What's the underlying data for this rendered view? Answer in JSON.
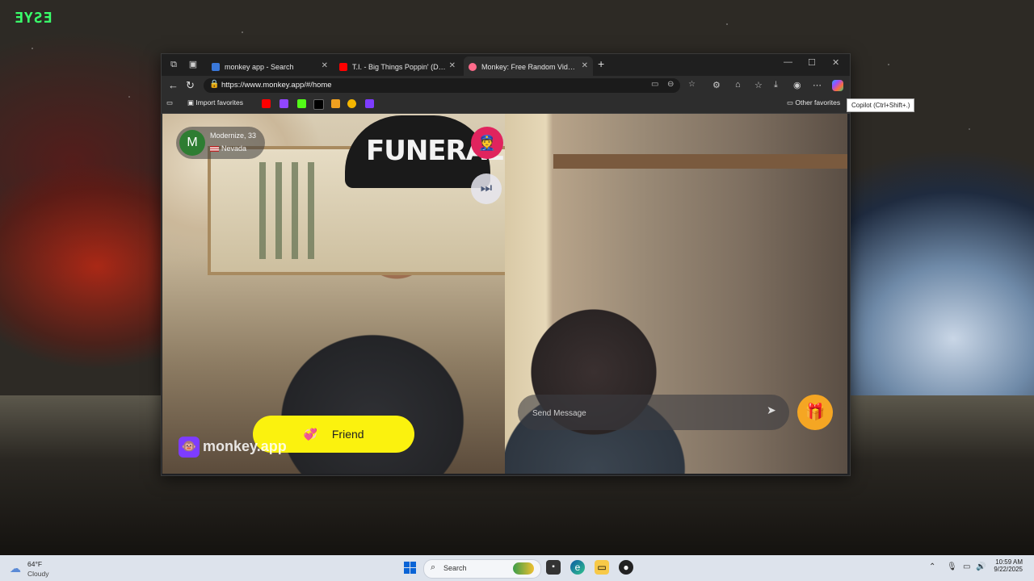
{
  "desktop": {
    "logo_text": "ƎYƧƎ"
  },
  "browser": {
    "tabs": [
      {
        "title": "monkey app - Search",
        "favicon_color": "#3a78d9"
      },
      {
        "title": "T.I. - Big Things Poppin' (Do It) [O…",
        "favicon_color": "#ff0000"
      },
      {
        "title": "Monkey: Free Random Video Chat",
        "favicon_color": "#ff6b8b",
        "active": true
      }
    ],
    "address": {
      "url": "https://www.monkey.app/#/home"
    },
    "favorites_bar": {
      "import_label": "Import favorites",
      "other_label": "Other favorites",
      "icons": [
        {
          "name": "youtube-favicon",
          "color": "#ff0000"
        },
        {
          "name": "twitch-favicon",
          "color": "#9146ff"
        },
        {
          "name": "kick-favicon",
          "color": "#53fc18"
        },
        {
          "name": "x-favicon",
          "color": "#000000"
        },
        {
          "name": "chess-favicon",
          "color": "#f0a020"
        },
        {
          "name": "spotify-favicon",
          "color": "#f5b700"
        },
        {
          "name": "purple-favicon",
          "color": "#7d3cff"
        }
      ]
    },
    "copilot_tooltip": "Copilot (Ctrl+Shift+.)"
  },
  "app": {
    "stranger": {
      "initial": "M",
      "name_age": "Modernize, 33",
      "location": "Nevada"
    },
    "cap_text": "FUNERAL",
    "friend_button": "Friend",
    "brand": "monkey.app",
    "message_placeholder": "Send Message"
  },
  "taskbar": {
    "weather": {
      "temp": "64°F",
      "condition": "Cloudy"
    },
    "search_label": "Search",
    "clock": {
      "time": "10:59 AM",
      "date": "9/22/2025"
    }
  },
  "colors": {
    "accent_yellow": "#fbf20e",
    "report_pink": "#e0245e",
    "gift_orange": "#f5a623",
    "brand_purple": "#7d3cff"
  }
}
